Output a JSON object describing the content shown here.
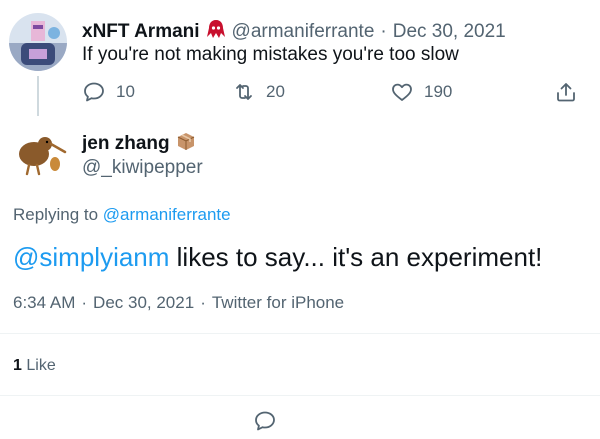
{
  "parent_tweet": {
    "display_name": "xNFT Armani",
    "badge_icon": "red-squid-emoji-icon",
    "handle": "@armaniferrante",
    "separator": "·",
    "date": "Dec 30, 2021",
    "text": "If you're not making mistakes you're too slow",
    "actions": {
      "reply_count": "10",
      "retweet_count": "20",
      "like_count": "190"
    }
  },
  "main_tweet": {
    "display_name": "jen zhang",
    "badge_icon": "package-emoji-icon",
    "handle": "@_kiwipepper",
    "replying_to_prefix": "Replying to",
    "replying_to_handle": "@armaniferrante",
    "body_mention": "@simplyianm",
    "body_rest": " likes to say... it's an experiment!",
    "meta": {
      "time": "6:34 AM",
      "sep1": "·",
      "date": "Dec 30, 2021",
      "sep2": "·",
      "source": "Twitter for iPhone"
    },
    "likes_count": "1",
    "likes_label": "Like"
  },
  "colors": {
    "link": "#1d9bf0",
    "muted": "#536471",
    "text": "#0f1419",
    "divider": "#eff3f4"
  }
}
